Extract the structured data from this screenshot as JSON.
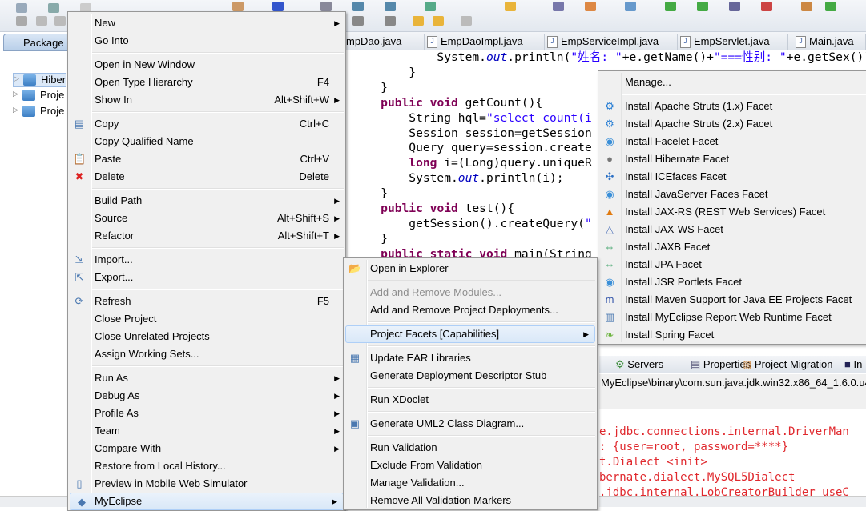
{
  "package_explorer": {
    "tab_label": "Package",
    "tree": [
      "Hiber",
      "Proje",
      "Proje"
    ]
  },
  "editor": {
    "tabs": [
      "mpDao.java",
      "EmpDaoImpl.java",
      "EmpServiceImpl.java",
      "EmpServlet.java",
      "Main.java"
    ],
    "code_lines": [
      "            System.<i>out</i>.println(<s>\"姓名: \"</s>+e.getName()+<s>\"===性别: \"</s>+e.getSex());",
      "        }",
      "    }",
      "    <k>public</k> <k>void</k> getCount(){",
      "        String hql=<s>\"select count(i</s>",
      "        Session session=getSession",
      "        Query query=session.create",
      "        <k>long</k> i=(Long)query.uniqueR",
      "        System.<i>out</i>.println(i);",
      "    }",
      "    <k>public</k> <k>void</k> test(){",
      "        getSession().createQuery(<s>\"</s>",
      "    }",
      "    <k>public</k> <k>static</k> <k>void</k> main(String"
    ]
  },
  "bottom_panel": {
    "tabs": [
      "Servers",
      "Properties",
      "Project Migration",
      "In"
    ],
    "path": "MyEclipse\\binary\\com.sun.java.jdk.win32.x86_64_1.6.0.u43",
    "console_lines": [
      "e.jdbc.connections.internal.DriverMan",
      ": {user=root, password=****}",
      "t.Dialect <init>",
      "bernate.dialect.MySQL5Dialect",
      ".jdbc.internal.LobCreatorBuilder useC"
    ]
  },
  "context_menu": {
    "items": [
      {
        "label": "New",
        "arrow": true
      },
      {
        "label": "Go Into"
      },
      {
        "sep": true
      },
      {
        "label": "Open in New Window"
      },
      {
        "label": "Open Type Hierarchy",
        "shortcut": "F4"
      },
      {
        "label": "Show In",
        "shortcut": "Alt+Shift+W",
        "arrow": true
      },
      {
        "sep": true
      },
      {
        "label": "Copy",
        "shortcut": "Ctrl+C",
        "icon": "copy-icon"
      },
      {
        "label": "Copy Qualified Name",
        "icon": "copy-qualified-icon"
      },
      {
        "label": "Paste",
        "shortcut": "Ctrl+V",
        "icon": "paste-icon"
      },
      {
        "label": "Delete",
        "shortcut": "Delete",
        "icon": "delete-icon"
      },
      {
        "sep": true
      },
      {
        "label": "Build Path",
        "arrow": true
      },
      {
        "label": "Source",
        "shortcut": "Alt+Shift+S",
        "arrow": true
      },
      {
        "label": "Refactor",
        "shortcut": "Alt+Shift+T",
        "arrow": true
      },
      {
        "sep": true
      },
      {
        "label": "Import...",
        "icon": "import-icon"
      },
      {
        "label": "Export...",
        "icon": "export-icon"
      },
      {
        "sep": true
      },
      {
        "label": "Refresh",
        "shortcut": "F5",
        "icon": "refresh-icon"
      },
      {
        "label": "Close Project"
      },
      {
        "label": "Close Unrelated Projects"
      },
      {
        "label": "Assign Working Sets..."
      },
      {
        "sep": true
      },
      {
        "label": "Run As",
        "arrow": true
      },
      {
        "label": "Debug As",
        "arrow": true
      },
      {
        "label": "Profile As",
        "arrow": true
      },
      {
        "label": "Team",
        "arrow": true
      },
      {
        "label": "Compare With",
        "arrow": true
      },
      {
        "label": "Restore from Local History..."
      },
      {
        "label": "Preview in Mobile Web Simulator",
        "icon": "mobile-icon"
      },
      {
        "label": "MyEclipse",
        "arrow": true,
        "icon": "myeclipse-icon",
        "highlighted": true
      }
    ]
  },
  "myeclipse_submenu": {
    "items": [
      {
        "label": "Open in Explorer",
        "icon": "folder-icon"
      },
      {
        "sep": true
      },
      {
        "label": "Add and Remove Modules...",
        "disabled": true
      },
      {
        "label": "Add and Remove Project Deployments..."
      },
      {
        "sep": true
      },
      {
        "label": "Project Facets [Capabilities]",
        "arrow": true,
        "highlighted": true
      },
      {
        "sep": true
      },
      {
        "label": "Update EAR Libraries",
        "icon": "ear-icon"
      },
      {
        "label": "Generate Deployment Descriptor Stub"
      },
      {
        "sep": true
      },
      {
        "label": "Run XDoclet"
      },
      {
        "sep": true
      },
      {
        "label": "Generate UML2 Class Diagram...",
        "icon": "uml-icon"
      },
      {
        "sep": true
      },
      {
        "label": "Run Validation"
      },
      {
        "label": "Exclude From Validation"
      },
      {
        "label": "Manage Validation..."
      },
      {
        "label": "Remove All Validation Markers"
      }
    ]
  },
  "facets_submenu": {
    "items": [
      {
        "label": "Manage..."
      },
      {
        "sep": true
      },
      {
        "label": "Install Apache Struts (1.x) Facet",
        "icon": "gear-icon"
      },
      {
        "label": "Install Apache Struts (2.x) Facet",
        "icon": "gear-icon"
      },
      {
        "label": "Install Facelet Facet",
        "icon": "facelet-icon"
      },
      {
        "label": "Install Hibernate Facet",
        "icon": "hibernate-icon"
      },
      {
        "label": "Install ICEfaces Facet",
        "icon": "icefaces-icon"
      },
      {
        "label": "Install JavaServer Faces Facet",
        "icon": "jsf-icon"
      },
      {
        "label": "Install JAX-RS (REST Web Services) Facet",
        "icon": "jaxrs-icon"
      },
      {
        "label": "Install JAX-WS Facet",
        "icon": "jaxws-icon"
      },
      {
        "label": "Install JAXB Facet",
        "icon": "jaxb-icon"
      },
      {
        "label": "Install JPA Facet",
        "icon": "jpa-icon"
      },
      {
        "label": "Install JSR Portlets Facet",
        "icon": "portlet-icon"
      },
      {
        "label": "Install Maven Support for Java EE Projects Facet",
        "icon": "maven-icon"
      },
      {
        "label": "Install MyEclipse Report Web Runtime Facet",
        "icon": "report-icon"
      },
      {
        "label": "Install Spring Facet",
        "icon": "spring-icon"
      }
    ]
  },
  "icon_glyphs": {
    "copy-icon": "▤",
    "copy-qualified-icon": "",
    "paste-icon": "📋",
    "delete-icon": "✖",
    "import-icon": "⇲",
    "export-icon": "⇱",
    "refresh-icon": "⟳",
    "mobile-icon": "▯",
    "myeclipse-icon": "◆",
    "folder-icon": "📂",
    "ear-icon": "▦",
    "uml-icon": "▣",
    "gear-icon": "⚙",
    "facelet-icon": "◉",
    "hibernate-icon": "●",
    "icefaces-icon": "✣",
    "jsf-icon": "◉",
    "jaxrs-icon": "▲",
    "jaxws-icon": "△",
    "jaxb-icon": "⇔",
    "jpa-icon": "⇔",
    "portlet-icon": "◉",
    "maven-icon": "m",
    "report-icon": "▥",
    "spring-icon": "❧"
  },
  "icon_colors": {
    "delete-icon": "#d22",
    "gear-icon": "#2a7fd4",
    "jaxrs-icon": "#e07a10",
    "maven-icon": "#3355aa",
    "spring-icon": "#6cb33e",
    "hibernate-icon": "#777",
    "jsf-icon": "#3a8fd8",
    "facelet-icon": "#3a8fd8",
    "portlet-icon": "#3a8fd8",
    "jaxb-icon": "#2a9a5a",
    "jpa-icon": "#2a9a5a",
    "icefaces-icon": "#2a6fc4",
    "jaxws-icon": "#5577bb"
  }
}
